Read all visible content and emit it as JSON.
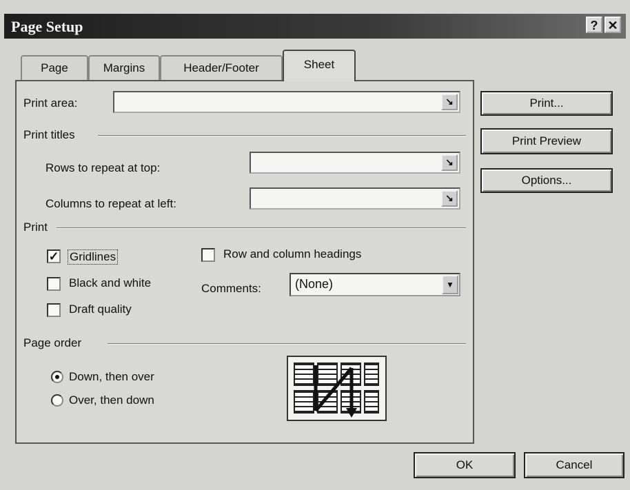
{
  "window": {
    "title": "Page Setup",
    "help_glyph": "?",
    "close_glyph": "✕"
  },
  "tabs": [
    {
      "label": "Page"
    },
    {
      "label": "Margins"
    },
    {
      "label": "Header/Footer"
    },
    {
      "label": "Sheet",
      "active": true
    }
  ],
  "sheet": {
    "print_area_label": "Print area:",
    "print_titles_label": "Print titles",
    "rows_label": "Rows to repeat at top:",
    "columns_label": "Columns to repeat at left:",
    "print_section_label": "Print",
    "gridlines": {
      "label": "Gridlines",
      "checked": true
    },
    "black_white": {
      "label": "Black and white",
      "checked": false
    },
    "draft": {
      "label": "Draft quality",
      "checked": false
    },
    "row_col_headings": {
      "label": "Row and column headings",
      "checked": false
    },
    "comments_label": "Comments:",
    "comments_value": "(None)",
    "page_order_label": "Page order",
    "down_then_over": {
      "label": "Down, then over",
      "selected": true
    },
    "over_then_down": {
      "label": "Over, then down",
      "selected": false
    }
  },
  "side_buttons": {
    "print": "Print...",
    "preview": "Print Preview",
    "options": "Options..."
  },
  "footer": {
    "ok": "OK",
    "cancel": "Cancel"
  },
  "icons": {
    "collapse": "collapse-dialog-icon",
    "dropdown": "chevron-down-icon",
    "check": "checkmark-icon"
  }
}
